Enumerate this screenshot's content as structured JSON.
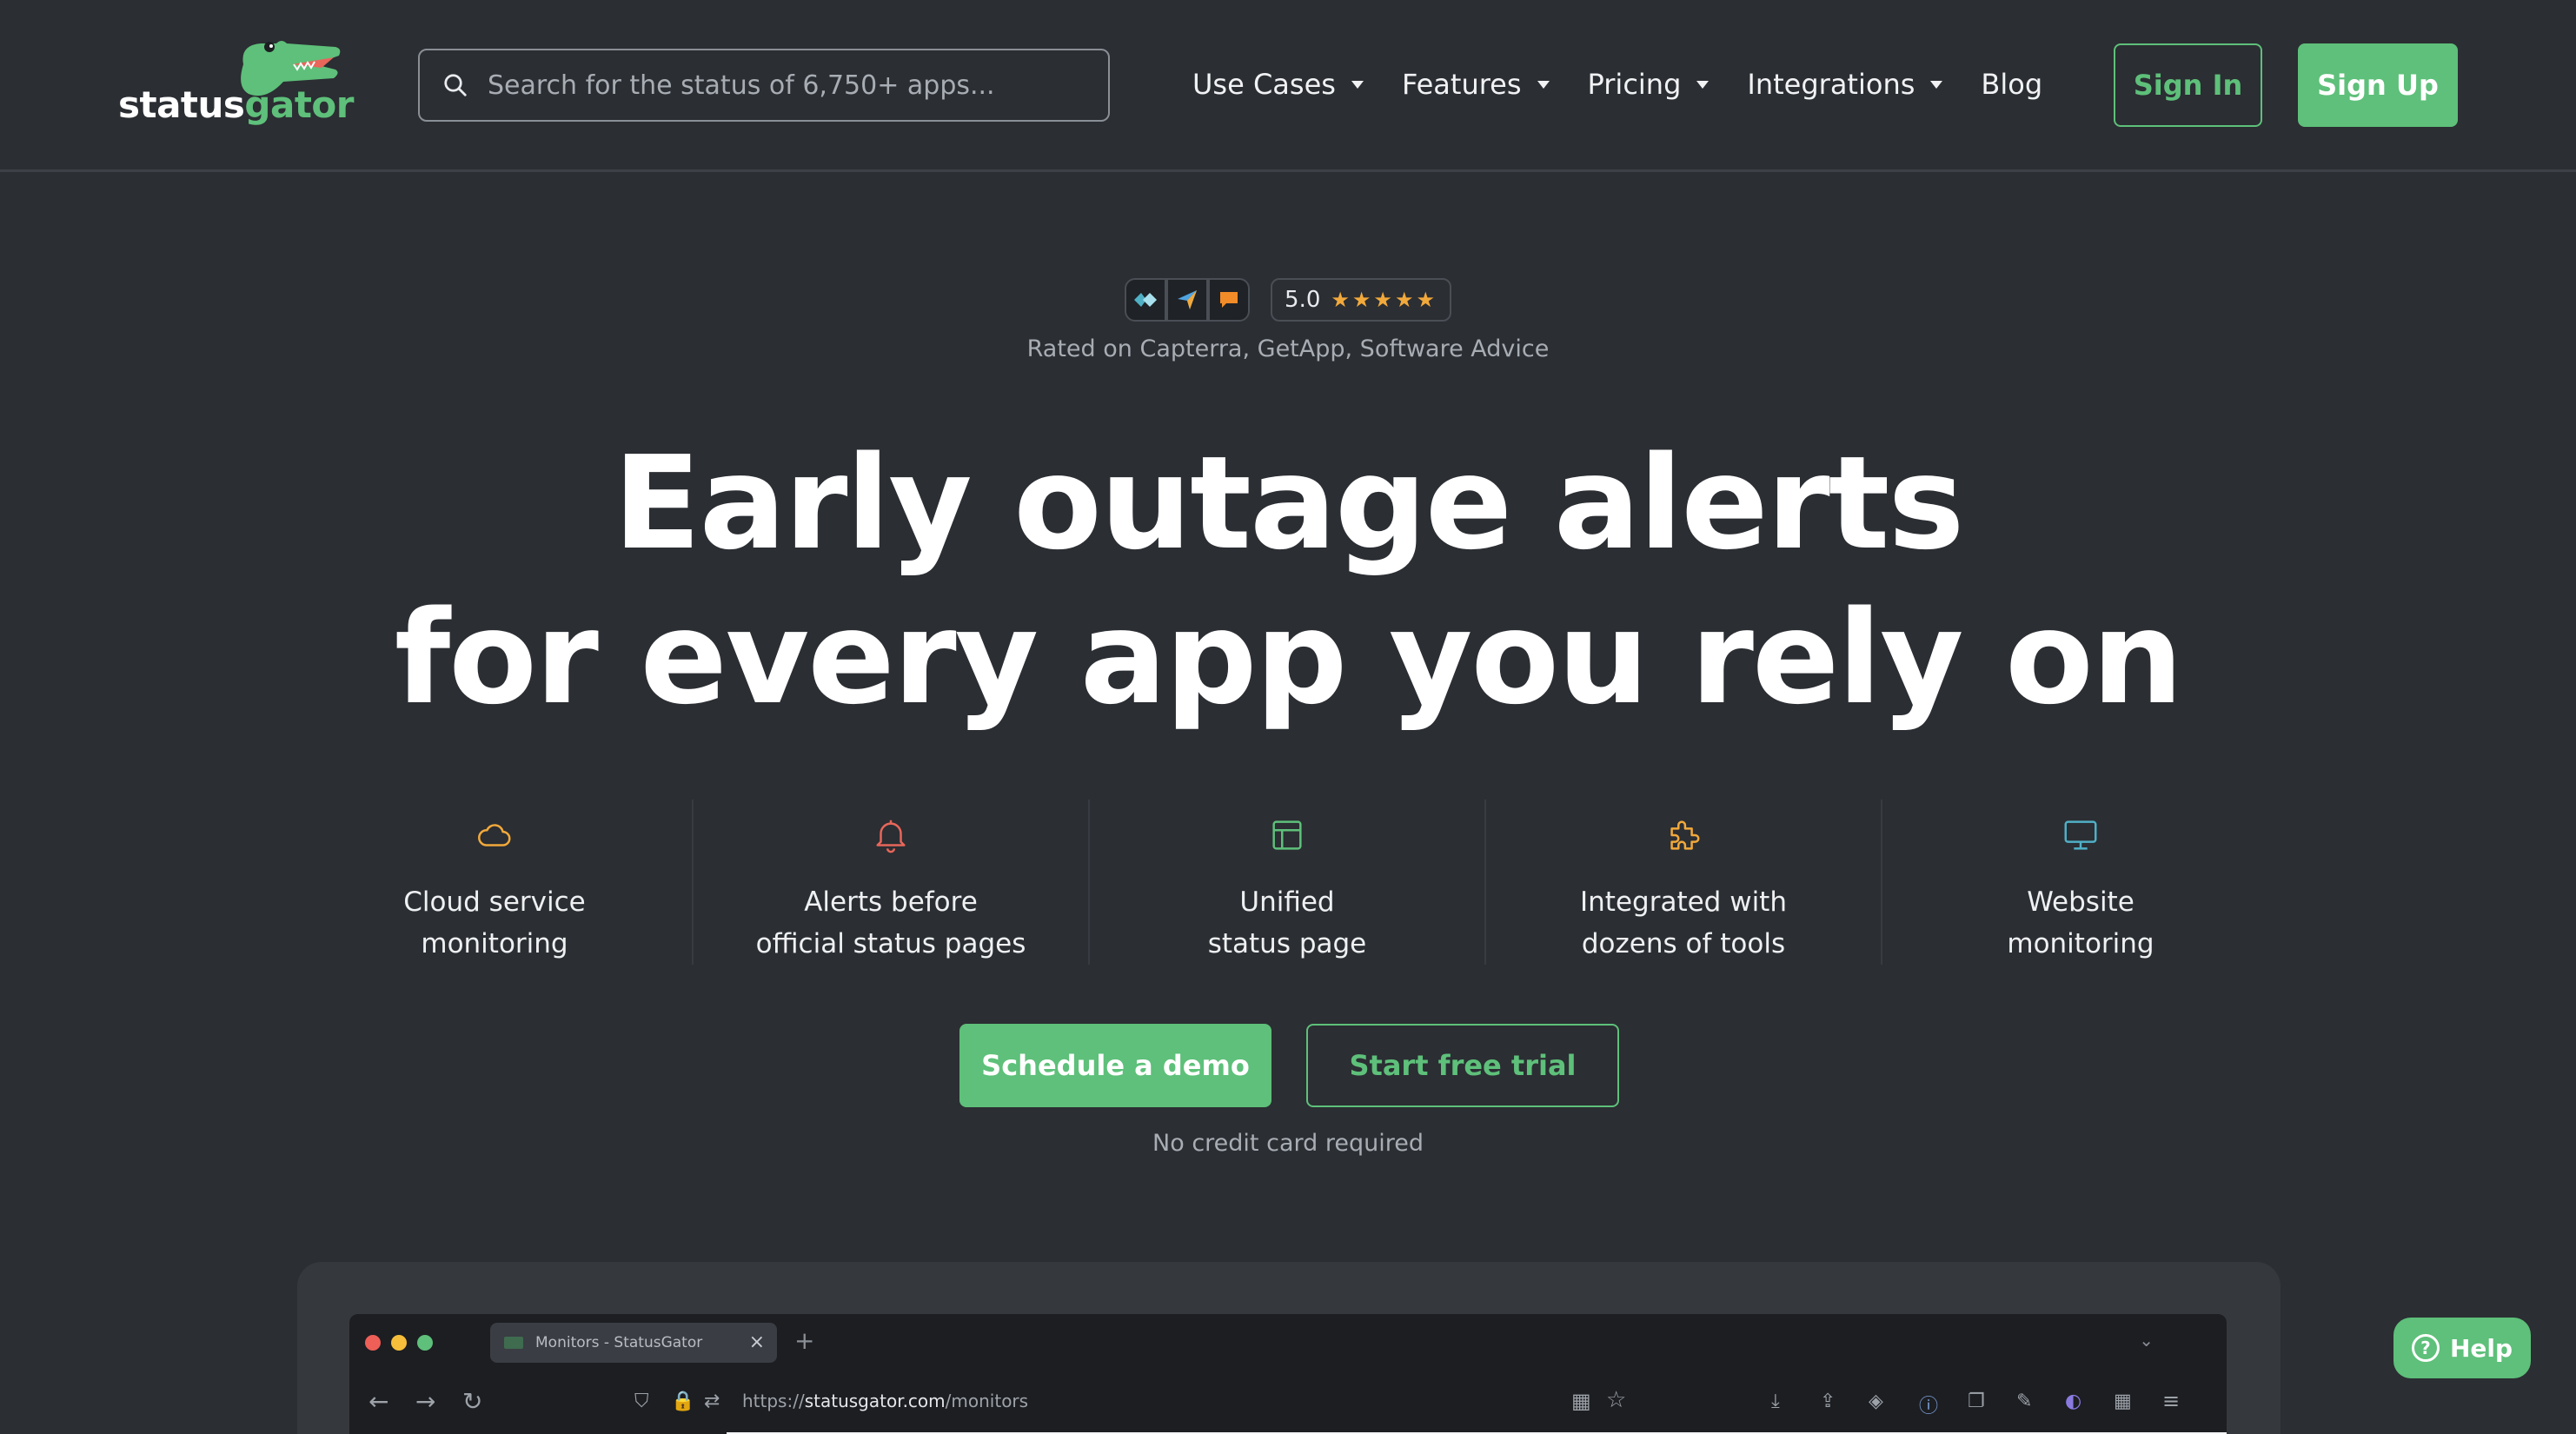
{
  "header": {
    "logo": {
      "part1": "status",
      "part2": "gator"
    },
    "search": {
      "placeholder": "Search for the status of 6,750+ apps..."
    },
    "nav": [
      {
        "label": "Use Cases",
        "dropdown": true
      },
      {
        "label": "Features",
        "dropdown": true
      },
      {
        "label": "Pricing",
        "dropdown": true
      },
      {
        "label": "Integrations",
        "dropdown": true
      },
      {
        "label": "Blog",
        "dropdown": false
      }
    ],
    "sign_in": "Sign In",
    "sign_up": "Sign Up"
  },
  "rating": {
    "score": "5.0",
    "stars": "★★★★★",
    "caption": "Rated on Capterra, GetApp, Software Advice"
  },
  "hero": {
    "line1": "Early outage alerts",
    "line2": "for every app you rely on"
  },
  "features": [
    {
      "icon": "cloud-icon",
      "line1": "Cloud service",
      "line2": "monitoring",
      "color": "#f2a93b"
    },
    {
      "icon": "bell-icon",
      "line1": "Alerts before",
      "line2": "official status pages",
      "color": "#e8665a"
    },
    {
      "icon": "layout-icon",
      "line1": "Unified",
      "line2": "status page",
      "color": "#5ec07a"
    },
    {
      "icon": "puzzle-icon",
      "line1": "Integrated with",
      "line2": "dozens of tools",
      "color": "#f2a93b"
    },
    {
      "icon": "monitor-icon",
      "line1": "Website",
      "line2": "monitoring",
      "color": "#4fb0c6"
    }
  ],
  "cta": {
    "demo": "Schedule a demo",
    "trial": "Start free trial",
    "note": "No credit card required"
  },
  "browser": {
    "tab_title": "Monitors - StatusGator",
    "url_scheme": "https://",
    "url_host": "statusgator.com",
    "url_path": "/monitors"
  },
  "help": {
    "label": "Help"
  },
  "colors": {
    "background": "#2b2e33",
    "accent": "#5ec07a",
    "star": "#f2a93b"
  }
}
